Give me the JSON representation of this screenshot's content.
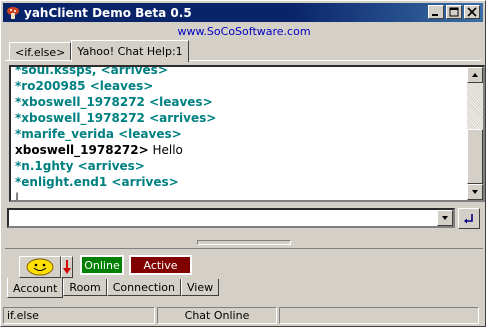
{
  "window": {
    "title": "yahClient Demo Beta 0.5",
    "url_text": "www.SoCoSoftware.com"
  },
  "top_tabs": [
    {
      "label": "<if.else>"
    },
    {
      "label": "Yahoo! Chat Help:1"
    }
  ],
  "chat": {
    "lines": [
      {
        "text": "*soul.kssps, <arrives>",
        "color": "#008080"
      },
      {
        "text": "*ro200985 <leaves>",
        "color": "#008080"
      },
      {
        "text": "*xboswell_1978272 <leaves>",
        "color": "#008080"
      },
      {
        "text": "*xboswell_1978272 <arrives>",
        "color": "#008080"
      },
      {
        "text": "*marife_verida <leaves>",
        "color": "#008080"
      },
      {
        "user": "xboswell_1978272>",
        "message": " Hello",
        "color": "#000000"
      },
      {
        "text": "*n.1ghty <arrives>",
        "color": "#008080"
      },
      {
        "text": "*enlight.end1 <arrives>",
        "color": "#008080"
      }
    ]
  },
  "input": {
    "value": ""
  },
  "status_buttons": {
    "online_label": "Online",
    "active_label": "Active",
    "online_color": "#008000",
    "active_color": "#800000"
  },
  "bottom_tabs": [
    {
      "label": "Account"
    },
    {
      "label": "Room"
    },
    {
      "label": "Connection"
    },
    {
      "label": "View"
    }
  ],
  "statusbar": {
    "user": "if.else",
    "status": "Chat Online"
  }
}
